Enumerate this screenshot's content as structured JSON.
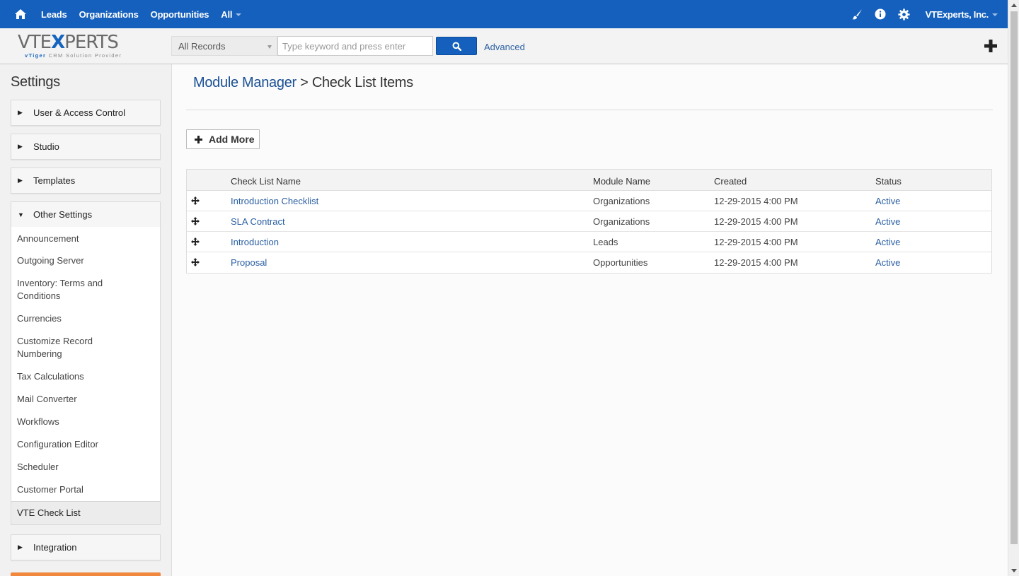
{
  "topnav": {
    "items": [
      "Leads",
      "Organizations",
      "Opportunities",
      "All"
    ],
    "account": "VTExperts, Inc.",
    "icons": [
      "home-icon",
      "brush-icon",
      "info-icon",
      "gear-icon"
    ]
  },
  "header": {
    "logo_main": "VTEXPERTS",
    "logo_tagline_brand": "vTiger",
    "logo_tagline_rest": "CRM Solution Provider",
    "records_select": "All Records",
    "search_placeholder": "Type keyword and press enter",
    "advanced_label": "Advanced"
  },
  "sidebar": {
    "title": "Settings",
    "sections": [
      "User & Access Control",
      "Studio",
      "Templates",
      "Other Settings",
      "Integration"
    ],
    "other_settings_items": [
      "Announcement",
      "Outgoing Server",
      "Inventory: Terms and Conditions",
      "Currencies",
      "Customize Record Numbering",
      "Tax Calculations",
      "Mail Converter",
      "Workflows",
      "Configuration Editor",
      "Scheduler",
      "Customer Portal",
      "VTE Check List"
    ]
  },
  "breadcrumb": {
    "parent": "Module Manager",
    "separator": ">",
    "current": "Check List Items"
  },
  "add_more_label": "Add More",
  "table": {
    "columns": [
      "Check List Name",
      "Module Name",
      "Created",
      "Status"
    ],
    "rows": [
      {
        "name": "Introduction Checklist",
        "module": "Organizations",
        "created": "12-29-2015 4:00 PM",
        "status": "Active"
      },
      {
        "name": "SLA Contract",
        "module": "Organizations",
        "created": "12-29-2015 4:00 PM",
        "status": "Active"
      },
      {
        "name": "Introduction",
        "module": "Leads",
        "created": "12-29-2015 4:00 PM",
        "status": "Active"
      },
      {
        "name": "Proposal",
        "module": "Opportunities",
        "created": "12-29-2015 4:00 PM",
        "status": "Active"
      }
    ]
  },
  "colors": {
    "topnav_bg": "#1560bd",
    "link": "#2a5fa3",
    "accent_orange": "#f0883e"
  }
}
